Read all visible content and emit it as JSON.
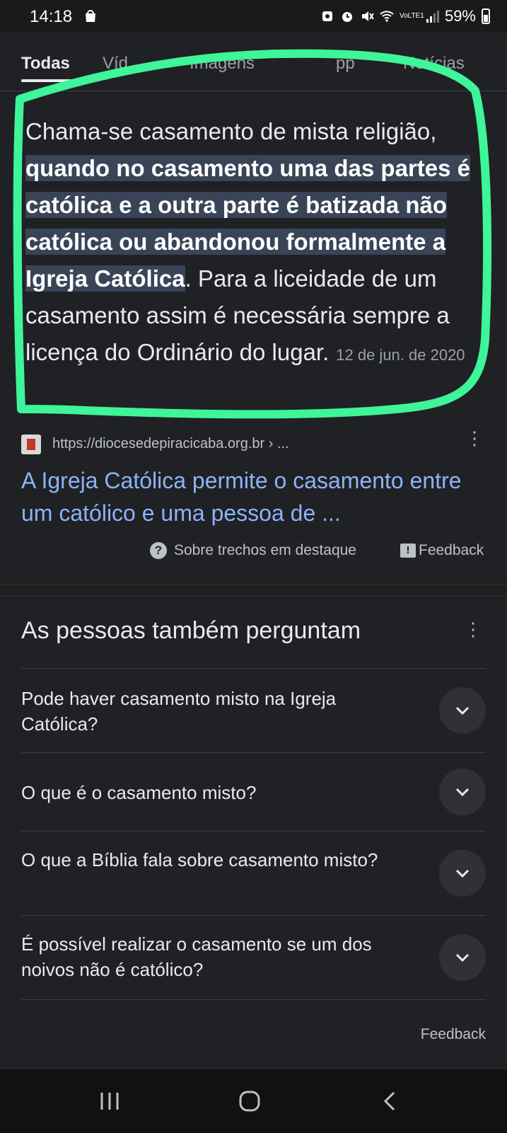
{
  "status_bar": {
    "time": "14:18",
    "network_label": "VoLTE1",
    "battery": "59%",
    "icons": [
      "shopping-bag-icon",
      "recycle-icon",
      "alarm-icon",
      "mute-icon",
      "wifi-icon",
      "signal-icon",
      "battery-icon"
    ]
  },
  "tabs": [
    "Todas",
    "Víd",
    "Imagens",
    "pp",
    "Notícias"
  ],
  "active_tab": "Todas",
  "snippet": {
    "text_before": "Chama-se casamento de mista religião, ",
    "highlighted": "quando no casamento uma das partes é católica e a outra parte é batizada não católica ou abandonou formalmente a Igreja Católica",
    "text_after": ". Para a liceidade de um casamento assim é necessária sempre a licença do Ordinário do lugar.",
    "date": "12 de jun. de 2020"
  },
  "source": {
    "url": "https://diocesedepiracicaba.org.br › ..."
  },
  "result_title": "A Igreja Católica permite o casamento entre um católico e uma pessoa de ...",
  "about_featured": "Sobre trechos em destaque",
  "feedback_label": "Feedback",
  "paa": {
    "title": "As pessoas também perguntam",
    "questions": [
      "Pode haver casamento misto na Igreja Católica?",
      "O que é o casamento misto?",
      "O que a Bíblia fala sobre casamento misto?",
      "É possível realizar o casamento se um dos noivos não é católico?"
    ]
  },
  "footer_feedback": "Feedback",
  "colors": {
    "background": "#202124",
    "link": "#8ab4f8",
    "highlight": "#394457",
    "marker": "#3ef59a"
  }
}
